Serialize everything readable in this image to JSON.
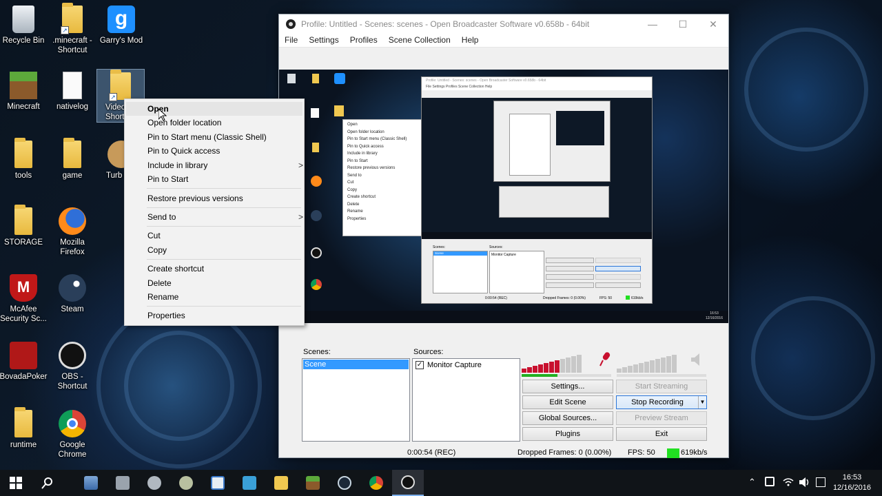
{
  "desktop": {
    "icons": [
      {
        "label": "Recycle Bin",
        "icon": "recycle-bin-icon"
      },
      {
        "label": ".minecraft - Shortcut",
        "icon": "folder-icon"
      },
      {
        "label": "Garry's Mod",
        "icon": "garrys-mod-icon"
      },
      {
        "label": "Minecraft",
        "icon": "minecraft-icon"
      },
      {
        "label": "nativelog",
        "icon": "text-file-icon"
      },
      {
        "label": "Video Shortc",
        "icon": "folder-icon"
      },
      {
        "label": "tools",
        "icon": "folder-icon"
      },
      {
        "label": "game",
        "icon": "folder-icon"
      },
      {
        "label": "Turb Dismo",
        "icon": "game-icon"
      },
      {
        "label": "STORAGE",
        "icon": "folder-icon"
      },
      {
        "label": "Mozilla Firefox",
        "icon": "firefox-icon"
      },
      {
        "label": "McAfee Security Sc...",
        "icon": "mcafee-icon"
      },
      {
        "label": "Steam",
        "icon": "steam-icon"
      },
      {
        "label": "BovadaPoker",
        "icon": "bovada-icon"
      },
      {
        "label": "OBS - Shortcut",
        "icon": "obs-icon"
      },
      {
        "label": "runtime",
        "icon": "folder-icon"
      },
      {
        "label": "Google Chrome",
        "icon": "chrome-icon"
      }
    ]
  },
  "obs": {
    "title": "Profile: Untitled - Scenes: scenes - Open Broadcaster Software v0.658b - 64bit",
    "menu": [
      "File",
      "Settings",
      "Profiles",
      "Scene Collection",
      "Help"
    ],
    "scenes_label": "Scenes:",
    "sources_label": "Sources:",
    "scene_items": [
      "Scene"
    ],
    "source_items": [
      "Monitor Capture"
    ],
    "buttons": {
      "settings": "Settings...",
      "start_streaming": "Start Streaming",
      "edit_scene": "Edit Scene",
      "stop_recording": "Stop Recording",
      "global_sources": "Global Sources...",
      "preview_stream": "Preview Stream",
      "plugins": "Plugins",
      "exit": "Exit"
    },
    "status": {
      "time": "0:00:54 (REC)",
      "dropped": "Dropped Frames: 0 (0.00%)",
      "fps": "FPS: 50",
      "bitrate": "619kb/s"
    },
    "colors": {
      "selection": "#3399ff",
      "bitrate_ok": "#21e021",
      "meter_active": "#c8102e"
    }
  },
  "mini_capture": {
    "title": "Profile: Untitled - Scenes: scenes - Open Broadcaster Software v0.658b - 64bit",
    "menu": "File   Settings   Profiles   Scene Collection   Help",
    "menu_items": [
      "Open",
      "Open folder location",
      "Pin to Start menu (Classic Shell)",
      "Pin to Quick access",
      "Include in library",
      "Pin to Start",
      "Restore previous versions",
      "Send to",
      "Cut",
      "Copy",
      "Create shortcut",
      "Delete",
      "Rename",
      "Properties"
    ],
    "scenes_label": "Scenes:",
    "sources_label": "Sources:",
    "scene": "Scene",
    "source": "Monitor Capture",
    "status_time": "0:00:54 (REC)",
    "status_dropped": "Dropped Frames: 0 (0.00%)",
    "status_fps": "FPS: 50",
    "status_bitrate": "619kb/s",
    "clock": "16:53",
    "date": "12/16/2016"
  },
  "context_menu": {
    "items": [
      {
        "label": "Open",
        "bold": true
      },
      {
        "label": "Open folder location"
      },
      {
        "label": "Pin to Start menu (Classic Shell)"
      },
      {
        "label": "Pin to Quick access"
      },
      {
        "label": "Include in library",
        "submenu": true
      },
      {
        "label": "Pin to Start"
      },
      {
        "label": "Restore previous versions"
      },
      {
        "label": "Send to",
        "submenu": true
      },
      {
        "label": "Cut"
      },
      {
        "label": "Copy"
      },
      {
        "label": "Create shortcut"
      },
      {
        "label": "Delete"
      },
      {
        "label": "Rename"
      },
      {
        "label": "Properties"
      }
    ],
    "submenu_glyph": ">"
  },
  "taskbar": {
    "icons": [
      "windows-start-icon",
      "search-icon",
      "app-icon-1",
      "app-icon-2",
      "app-icon-3",
      "app-icon-4",
      "app-icon-5",
      "app-icon-6",
      "file-explorer-icon",
      "minecraft-icon",
      "steam-icon",
      "chrome-icon",
      "obs-icon"
    ],
    "time": "16:53",
    "date": "12/16/2016"
  }
}
